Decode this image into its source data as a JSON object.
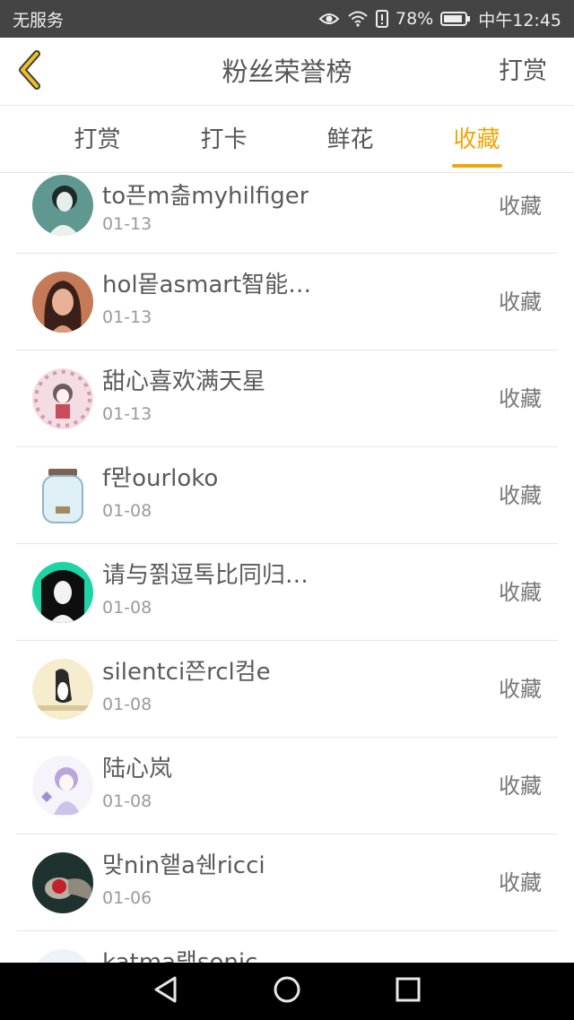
{
  "status_bar": {
    "carrier": "无服务",
    "battery": "78%",
    "time": "中午12:45"
  },
  "header": {
    "title": "粉丝荣誉榜",
    "action_label": "打赏",
    "back_icon": "chevron-left-icon",
    "accent": "#f0a50a"
  },
  "tabs": [
    {
      "label": "打赏",
      "active": false
    },
    {
      "label": "打卡",
      "active": false
    },
    {
      "label": "鲜花",
      "active": false
    },
    {
      "label": "收藏",
      "active": true
    }
  ],
  "list": [
    {
      "name": "to픈m츪myhilfiger",
      "date": "01-13",
      "action": "收藏"
    },
    {
      "name": "hol뫁asmart智能…",
      "date": "01-13",
      "action": "收藏"
    },
    {
      "name": "甜心喜欢满天星",
      "date": "01-13",
      "action": "收藏"
    },
    {
      "name": "f뫈ourloko",
      "date": "01-08",
      "action": "收藏"
    },
    {
      "name": "请与쬙逗톡比同归…",
      "date": "01-08",
      "action": "收藏"
    },
    {
      "name": "silentci쯘rcl컴e",
      "date": "01-08",
      "action": "收藏"
    },
    {
      "name": "陆心岚",
      "date": "01-08",
      "action": "收藏"
    },
    {
      "name": "맞nin햍a쉔ricci",
      "date": "01-06",
      "action": "收藏"
    },
    {
      "name": "katma랩sonic",
      "date": "",
      "action": ""
    }
  ],
  "nav_bar": {
    "back_icon": "nav-back-icon",
    "home_icon": "nav-home-icon",
    "recents_icon": "nav-recents-icon"
  }
}
